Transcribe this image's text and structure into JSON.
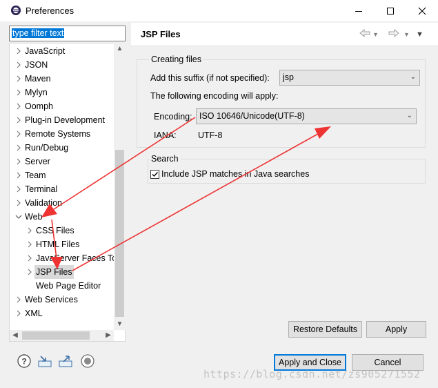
{
  "window": {
    "title": "Preferences"
  },
  "filter": {
    "value": "type filter text"
  },
  "tree": {
    "items": [
      {
        "label": "JavaScript",
        "level": 0,
        "expandable": true,
        "expanded": false
      },
      {
        "label": "JSON",
        "level": 0,
        "expandable": true,
        "expanded": false
      },
      {
        "label": "Maven",
        "level": 0,
        "expandable": true,
        "expanded": false
      },
      {
        "label": "Mylyn",
        "level": 0,
        "expandable": true,
        "expanded": false
      },
      {
        "label": "Oomph",
        "level": 0,
        "expandable": true,
        "expanded": false
      },
      {
        "label": "Plug-in Development",
        "level": 0,
        "expandable": true,
        "expanded": false
      },
      {
        "label": "Remote Systems",
        "level": 0,
        "expandable": true,
        "expanded": false
      },
      {
        "label": "Run/Debug",
        "level": 0,
        "expandable": true,
        "expanded": false
      },
      {
        "label": "Server",
        "level": 0,
        "expandable": true,
        "expanded": false
      },
      {
        "label": "Team",
        "level": 0,
        "expandable": true,
        "expanded": false
      },
      {
        "label": "Terminal",
        "level": 0,
        "expandable": true,
        "expanded": false
      },
      {
        "label": "Validation",
        "level": 0,
        "expandable": true,
        "expanded": false
      },
      {
        "label": "Web",
        "level": 0,
        "expandable": true,
        "expanded": true
      },
      {
        "label": "CSS Files",
        "level": 1,
        "expandable": true,
        "expanded": false
      },
      {
        "label": "HTML Files",
        "level": 1,
        "expandable": true,
        "expanded": false
      },
      {
        "label": "JavaServer Faces To",
        "level": 1,
        "expandable": true,
        "expanded": false
      },
      {
        "label": "JSP Files",
        "level": 1,
        "expandable": true,
        "expanded": false,
        "selected": true
      },
      {
        "label": "Web Page Editor",
        "level": 1,
        "expandable": false,
        "expanded": false
      },
      {
        "label": "Web Services",
        "level": 0,
        "expandable": true,
        "expanded": false
      },
      {
        "label": "XML",
        "level": 0,
        "expandable": true,
        "expanded": false
      }
    ]
  },
  "page": {
    "title": "JSP Files",
    "creating_files": {
      "group_title": "Creating files",
      "suffix_label": "Add this suffix (if not specified):",
      "suffix_value": "jsp",
      "encoding_intro": "The following encoding will apply:",
      "encoding_label": "Encoding:",
      "encoding_value": "ISO 10646/Unicode(UTF-8)",
      "iana_label": "IANA:",
      "iana_value": "UTF-8"
    },
    "search": {
      "group_title": "Search",
      "include_label": "Include JSP matches in Java searches",
      "include_checked": true
    },
    "restore_defaults_label": "Restore Defaults",
    "apply_label": "Apply"
  },
  "footer": {
    "apply_close_label": "Apply and Close",
    "cancel_label": "Cancel"
  },
  "watermark": "https://blog.csdn.net/zs905271552",
  "colors": {
    "selection": "#0078d7",
    "annotation_arrow": "#ee3333"
  }
}
